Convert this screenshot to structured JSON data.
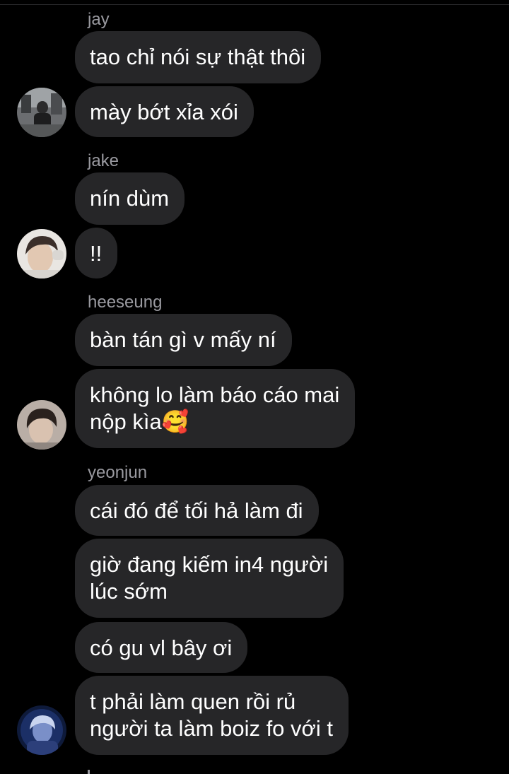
{
  "colors": {
    "background": "#000000",
    "bubble": "#262628",
    "text": "#ffffff",
    "sender_name": "#9a9aa0"
  },
  "groups": [
    {
      "sender": "jay",
      "avatar": "avatar-photo-jay",
      "messages": [
        "tao chỉ nói sự thật thôi",
        "mày bớt xỉa xói"
      ]
    },
    {
      "sender": "jake",
      "avatar": "avatar-photo-jake",
      "messages": [
        "nín dùm",
        "!!"
      ]
    },
    {
      "sender": "heeseung",
      "avatar": "avatar-photo-heeseung",
      "messages": [
        "bàn tán gì v mấy ní",
        "không lo làm báo cáo mai\nnộp kìa🥰"
      ]
    },
    {
      "sender": "yeonjun",
      "avatar": "avatar-photo-yeonjun",
      "messages": [
        "cái đó để tối hả làm đi",
        "giờ đang kiếm in4 người\nlúc sớm",
        "có gu vl bây ơi",
        "t phải làm quen rồi rủ\nngười ta làm boiz fo với t"
      ]
    }
  ]
}
